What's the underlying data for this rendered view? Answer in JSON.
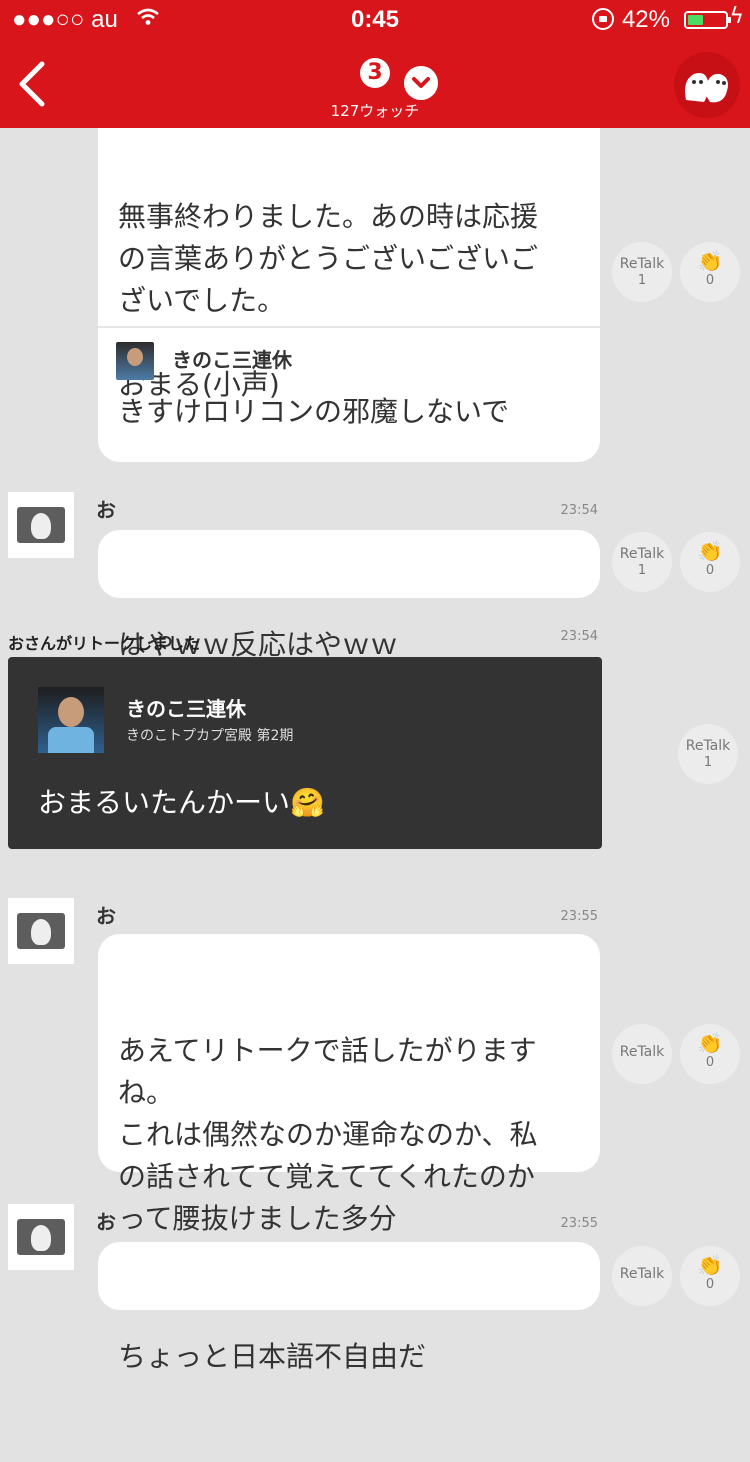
{
  "status_bar": {
    "carrier": "●●●○○ au",
    "time": "0:45",
    "battery": "42%",
    "battery_level": 0.42
  },
  "nav": {
    "badge": "3",
    "watch_count": "127ウォッチ"
  },
  "messages": [
    {
      "text": "無事終わりました。あの時は応援\nの言葉ありがとうございございご\nざいでした。\n\nおまる(小声)",
      "quote": {
        "name": "きのこ三連休",
        "text": "きすけロリコンの邪魔しないで"
      },
      "retalk_label": "ReTalk",
      "retalk_count": "1",
      "clap_count": "0"
    },
    {
      "sender": "お",
      "time": "23:54",
      "text": "はやｗｗ反応はやｗｗ",
      "retalk_label": "ReTalk",
      "retalk_count": "1",
      "clap_count": "0"
    },
    {
      "retalk_notice": "おさんがリトークしました",
      "time": "23:54",
      "name": "きのこ三連休",
      "subtitle": "きのこトプカプ宮殿 第2期",
      "text": "おまるいたんかーい🤗",
      "retalk_label": "ReTalk",
      "retalk_count": "1"
    },
    {
      "sender": "お",
      "time": "23:55",
      "text": "あえてリトークで話したがります\nね。\nこれは偶然なのか運命なのか、私\nの話されてて覚えててくれたのか\nって腰抜けました多分",
      "retalk_label": "ReTalk",
      "clap_count": "0"
    },
    {
      "sender": "お",
      "time": "23:55",
      "text": "ちょっと日本語不自由だ",
      "retalk_label": "ReTalk",
      "clap_count": "0"
    }
  ]
}
